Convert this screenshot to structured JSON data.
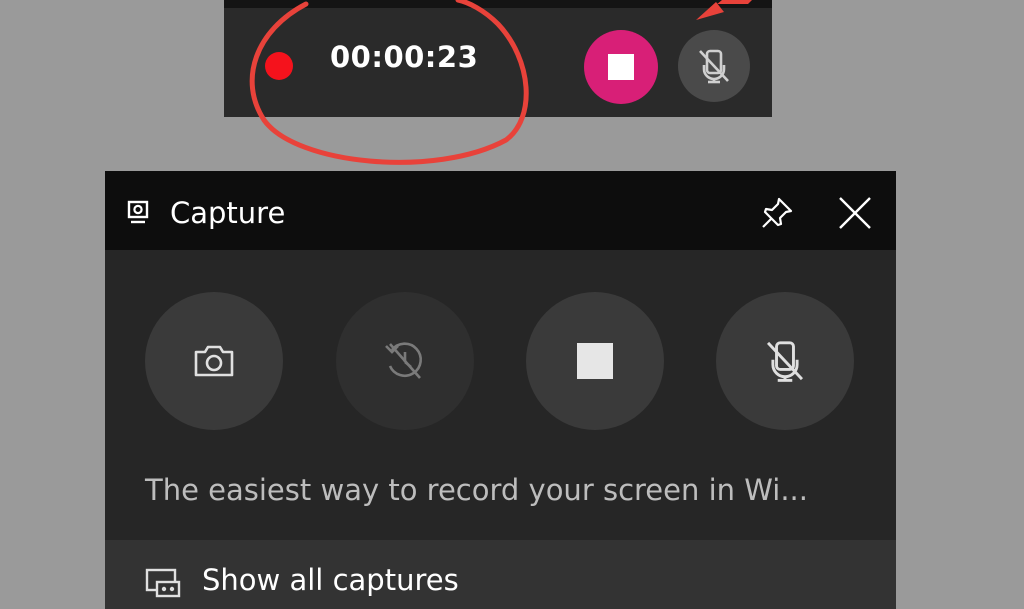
{
  "recording_bar": {
    "timer": "00:00:23",
    "stop_icon": "stop-square-icon",
    "mic_icon": "mic-muted-icon",
    "recording_color": "#f5121c",
    "stop_button_color": "#d81f77"
  },
  "annotation": {
    "color": "#e8423a"
  },
  "capture": {
    "title": "Capture",
    "title_icon": "capture-widget-icon",
    "pin_icon": "pin-icon",
    "close_icon": "close-icon",
    "buttons": [
      {
        "icon": "camera-icon",
        "enabled": true
      },
      {
        "icon": "record-last-icon",
        "enabled": false
      },
      {
        "icon": "stop-square-icon",
        "enabled": true
      },
      {
        "icon": "mic-muted-icon",
        "enabled": true
      }
    ],
    "description": "The easiest way to record your screen in Wi...",
    "show_all_label": "Show all captures",
    "show_all_icon": "gallery-icon"
  }
}
